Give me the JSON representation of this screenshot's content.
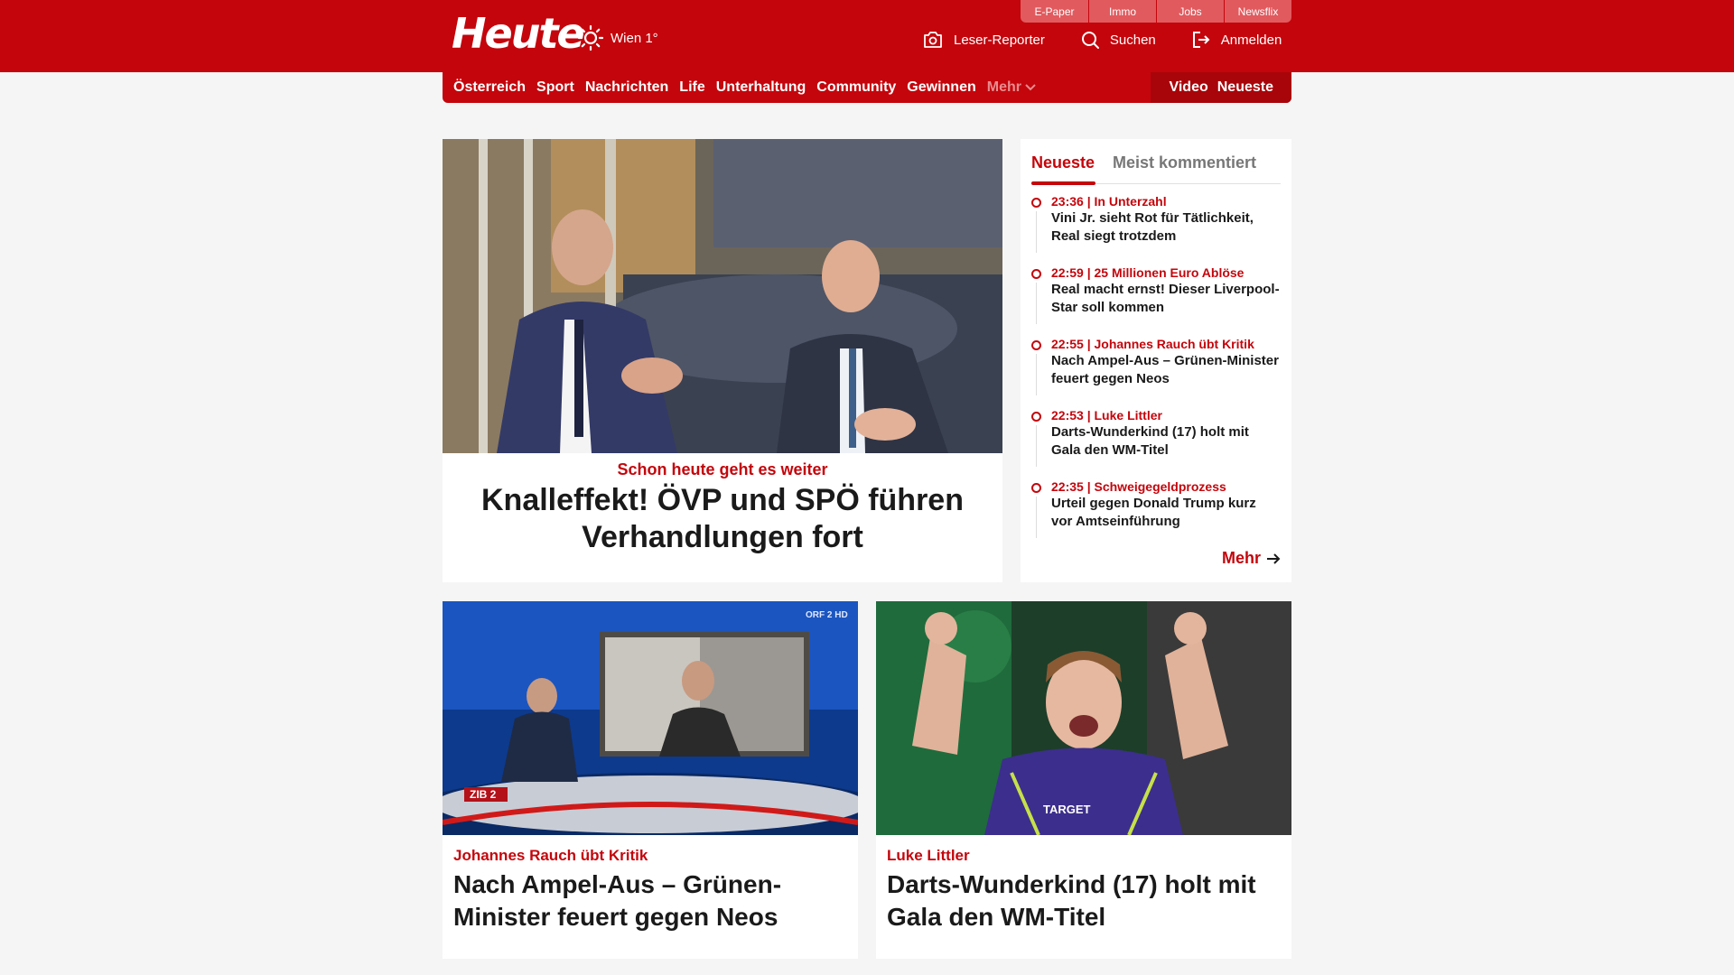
{
  "header": {
    "logo": "Heute",
    "weather": "Wien 1°",
    "top_links": [
      "E-Paper",
      "Immo",
      "Jobs",
      "Newsflix"
    ],
    "actions": {
      "reporter": "Leser-Reporter",
      "search": "Suchen",
      "login": "Anmelden"
    }
  },
  "nav": {
    "items": [
      "Österreich",
      "Sport",
      "Nachrichten",
      "Life",
      "Unterhaltung",
      "Community",
      "Gewinnen"
    ],
    "more": "Mehr",
    "right": [
      "Video",
      "Neueste"
    ]
  },
  "hero": {
    "kicker": "Schon heute geht es weiter",
    "title": "Knalleffekt! ÖVP und SPÖ führen Verhandlungen fort"
  },
  "sidebar": {
    "tabs": [
      "Neueste",
      "Meist kommentiert"
    ],
    "items": [
      {
        "meta": "23:36 | In Unterzahl",
        "title": "Vini Jr. sieht Rot für Tätlichkeit, Real siegt trotzdem"
      },
      {
        "meta": "22:59 | 25 Millionen Euro Ablöse",
        "title": "Real macht ernst! Dieser Liverpool-Star soll kommen"
      },
      {
        "meta": "22:55 | Johannes Rauch übt Kritik",
        "title": "Nach Ampel-Aus – Grünen-Minister feuert gegen Neos"
      },
      {
        "meta": "22:53 | Luke Littler",
        "title": "Darts-Wunderkind (17) holt mit Gala den WM-Titel"
      },
      {
        "meta": "22:35 | Schweigegeldprozess",
        "title": "Urteil gegen Donald Trump kurz vor Amtseinführung"
      }
    ],
    "more": "Mehr"
  },
  "cards": [
    {
      "kicker": "Johannes Rauch übt Kritik",
      "title": "Nach Ampel-Aus – Grünen-Minister feuert gegen Neos",
      "badge": "ZIB 2",
      "channel": "ORF 2 HD"
    },
    {
      "kicker": "Luke Littler",
      "title": "Darts-Wunderkind (17) holt mit Gala den WM-Titel",
      "shirt": "TARGET"
    }
  ]
}
